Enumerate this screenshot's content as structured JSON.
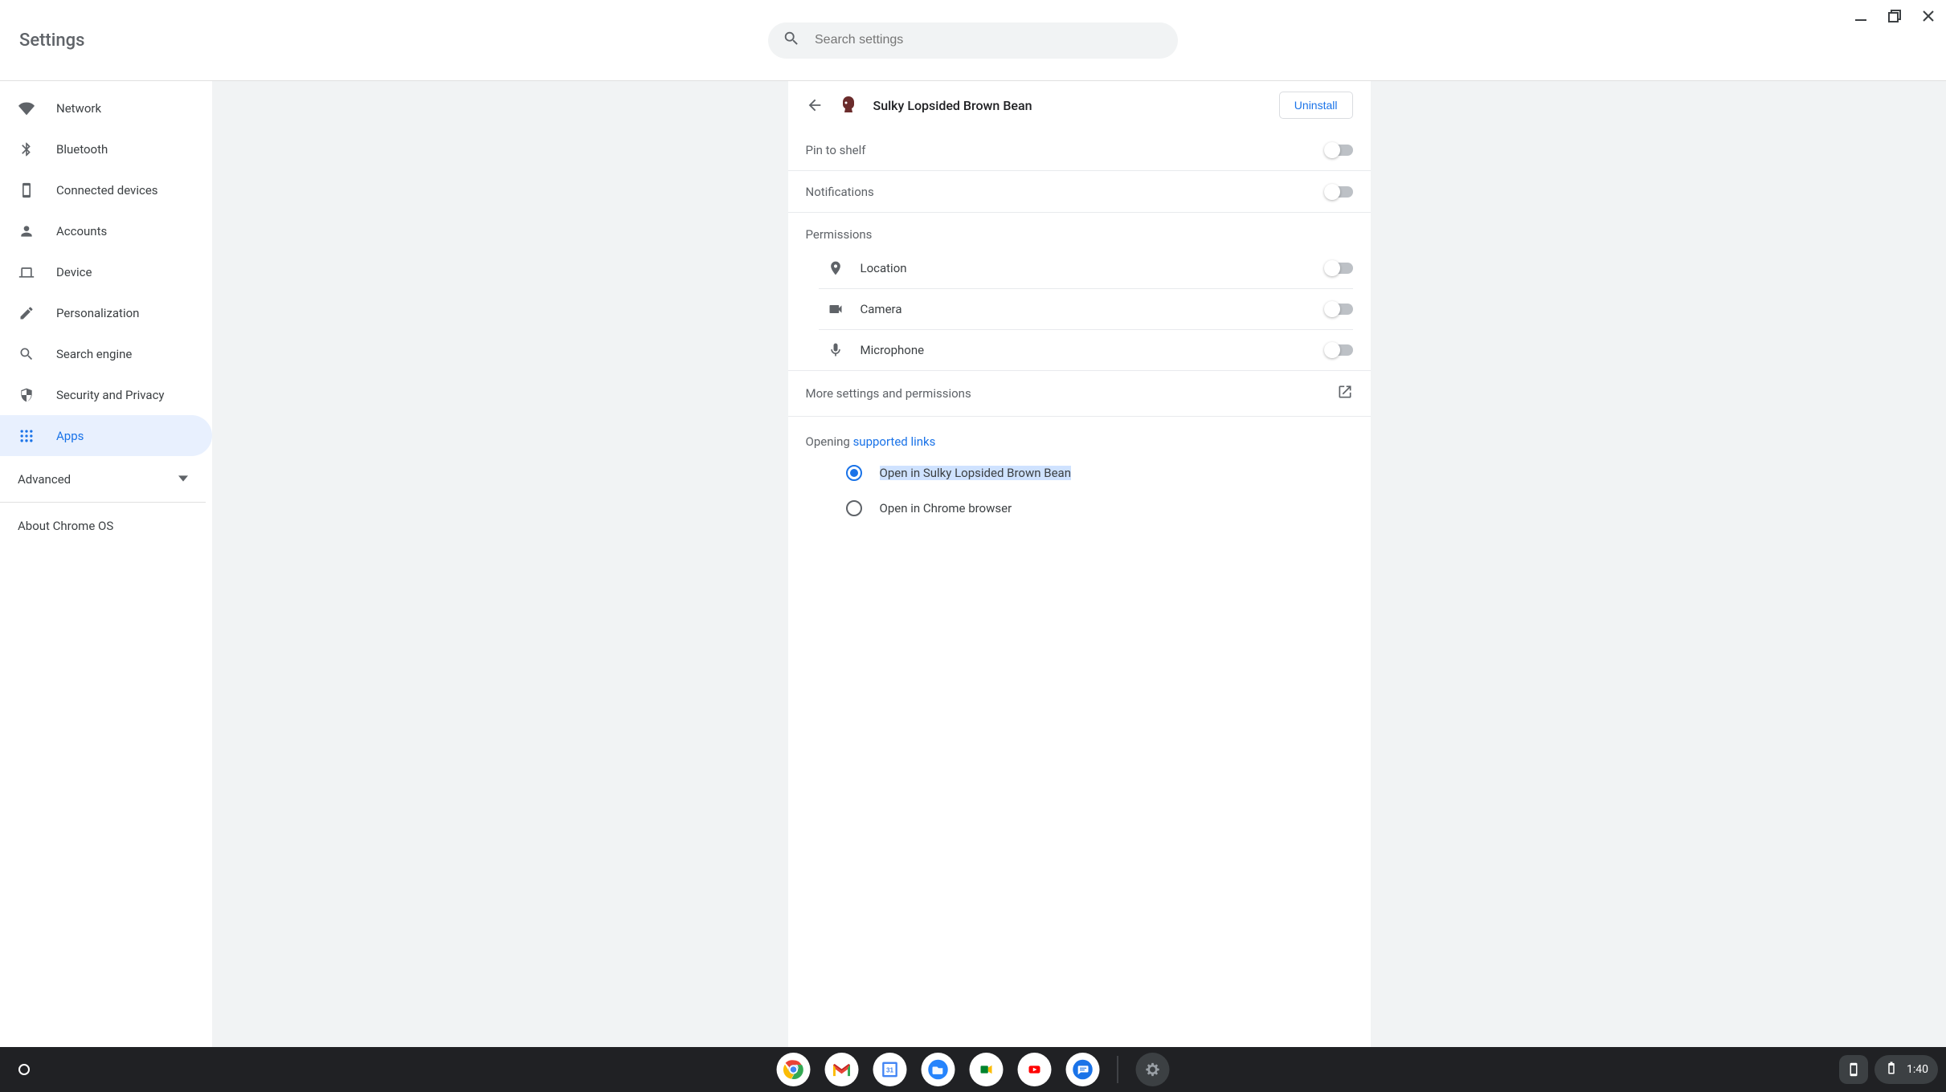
{
  "header": {
    "title": "Settings",
    "search_placeholder": "Search settings"
  },
  "sidebar": {
    "items": [
      {
        "label": "Network"
      },
      {
        "label": "Bluetooth"
      },
      {
        "label": "Connected devices"
      },
      {
        "label": "Accounts"
      },
      {
        "label": "Device"
      },
      {
        "label": "Personalization"
      },
      {
        "label": "Search engine"
      },
      {
        "label": "Security and Privacy"
      },
      {
        "label": "Apps"
      }
    ],
    "advanced": "Advanced",
    "about": "About Chrome OS"
  },
  "app": {
    "name": "Sulky Lopsided Brown Bean",
    "uninstall": "Uninstall",
    "pin": "Pin to shelf",
    "notifications": "Notifications",
    "permissions_label": "Permissions",
    "permissions": [
      {
        "label": "Location"
      },
      {
        "label": "Camera"
      },
      {
        "label": "Microphone"
      }
    ],
    "more": "More settings and permissions",
    "opening_prefix": "Opening ",
    "opening_link": "supported links",
    "radios": [
      {
        "label": "Open in Sulky Lopsided Brown Bean"
      },
      {
        "label": "Open in Chrome browser"
      }
    ]
  },
  "shelf": {
    "time": "1:40"
  }
}
